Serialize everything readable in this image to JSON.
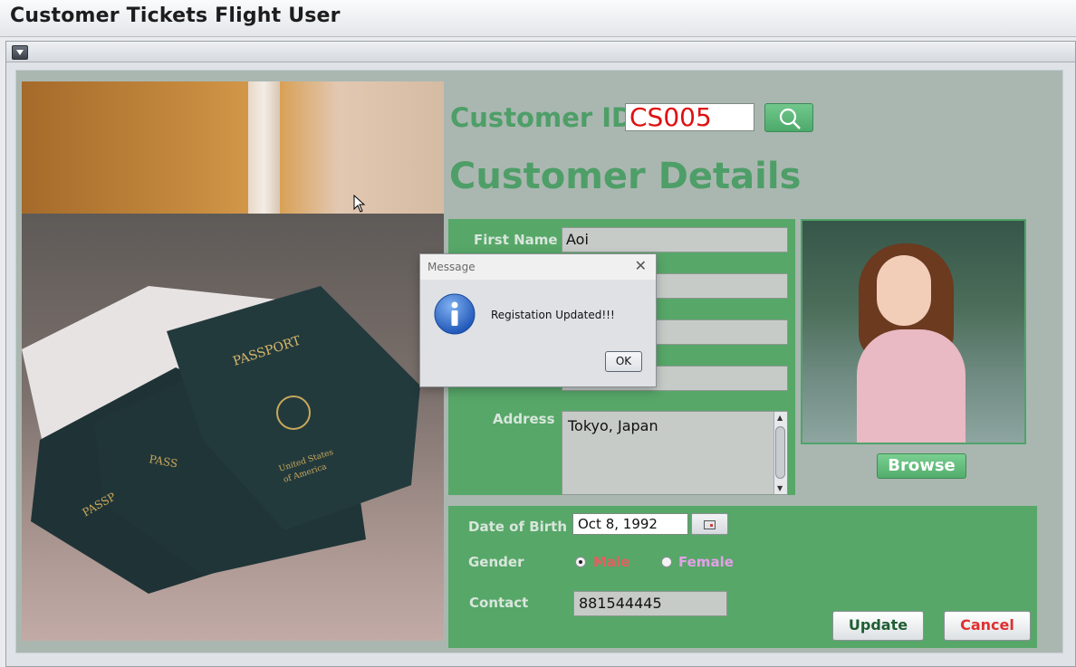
{
  "window": {
    "title": "Customer Tickets Flight User"
  },
  "form": {
    "customer_id_label": "Customer ID",
    "customer_id_value": "CS005",
    "section_title": "Customer Details",
    "first_name_label": "First Name",
    "first_name_value": "Aoi",
    "address_label": "Address",
    "address_value": "Tokyo, Japan",
    "browse_label": "Browse",
    "dob_label": "Date of Birth",
    "dob_value": "Oct 8, 1992",
    "gender_label": "Gender",
    "gender_options": [
      "Male",
      "Female"
    ],
    "gender_selected": "Male",
    "contact_label": "Contact",
    "contact_value": "881544445",
    "update_label": "Update",
    "cancel_label": "Cancel"
  },
  "dialog": {
    "title": "Message",
    "message": "Registation Updated!!!",
    "ok_label": "OK",
    "close_glyph": "✕"
  },
  "colors": {
    "accent_green": "#57a768",
    "title_green": "#4e9e68",
    "id_red": "#e01010",
    "male_color": "#e06060",
    "female_color": "#e4a0e8",
    "cancel_color": "#e03030"
  }
}
